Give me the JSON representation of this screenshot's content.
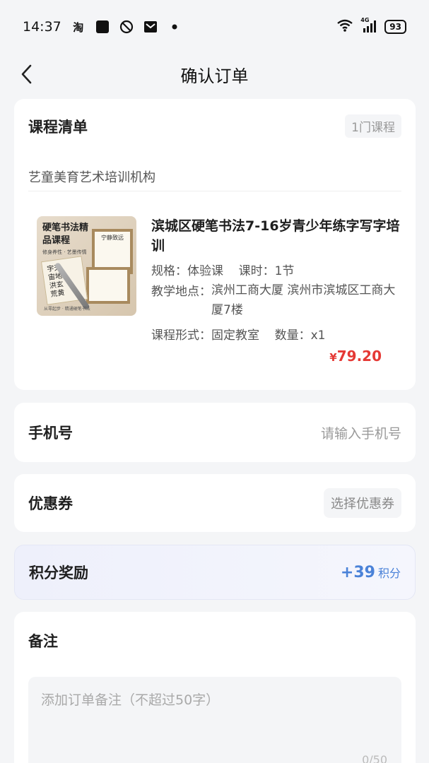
{
  "status": {
    "time": "14:37",
    "taobao_glyph": "淘",
    "network": "4G",
    "battery": "93"
  },
  "header": {
    "title": "确认订单"
  },
  "courses": {
    "section_title": "课程清单",
    "count_tag": "1门课程",
    "org_name": "艺童美育艺术培训机构",
    "thumbnail": {
      "title": "硬笔书法精品课程",
      "subtitle": "修身养性 · 艺墨传情",
      "paper1": "宇天宙地洪玄荒黄",
      "paper2": "宁静致远",
      "footer": "从零起步 · 精通硬笔书法"
    },
    "item": {
      "name": "滨城区硬笔书法7-16岁青少年练字写字培训",
      "spec": "规格：体验课    课时：1节",
      "location_label": "教学地点：",
      "location_value": "滨州工商大厦 滨州市滨城区工商大厦7楼",
      "form": "课程形式：固定教室    数量：x1",
      "price_symbol": "¥",
      "price": "79.20"
    }
  },
  "phone": {
    "label": "手机号",
    "placeholder": "请输入手机号"
  },
  "coupon": {
    "label": "优惠券",
    "button": "选择优惠券"
  },
  "points": {
    "label": "积分奖励",
    "value": "+39",
    "unit": "积分"
  },
  "remark": {
    "label": "备注",
    "placeholder": "添加订单备注（不超过50字）",
    "counter": "0/50"
  },
  "colors": {
    "price": "#e53935",
    "points": "#4a82d8"
  }
}
